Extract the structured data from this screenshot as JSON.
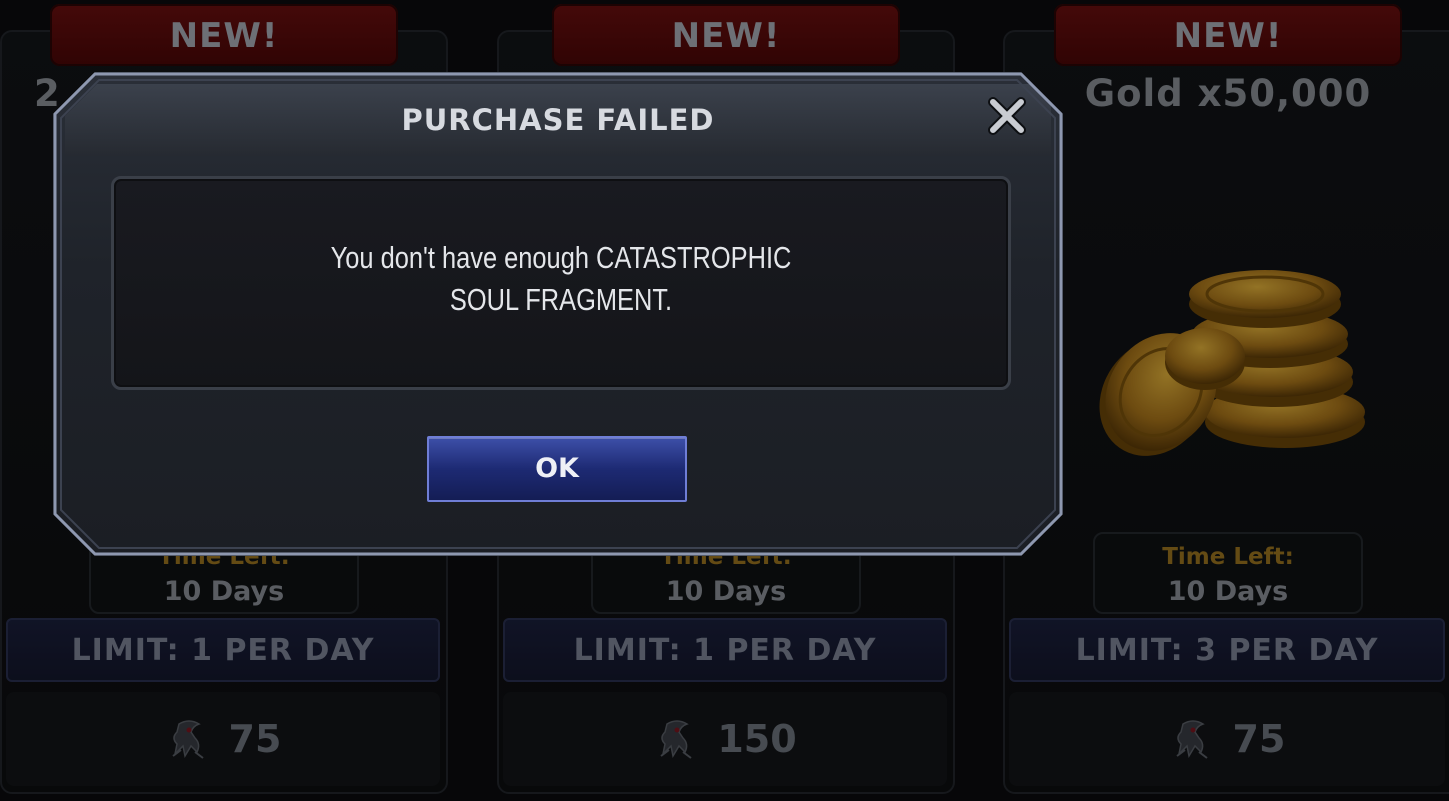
{
  "cards": [
    {
      "banner": "NEW!",
      "title": "2",
      "time_label": "Time Left:",
      "time_value": "10 Days",
      "limit": "LIMIT: 1 PER DAY",
      "price": "75",
      "currency_icon": "catastrophic-soul-fragment-icon"
    },
    {
      "banner": "NEW!",
      "title": "",
      "time_label": "Time Left:",
      "time_value": "10 Days",
      "limit": "LIMIT: 1 PER DAY",
      "price": "150",
      "currency_icon": "catastrophic-soul-fragment-icon"
    },
    {
      "banner": "NEW!",
      "title": "Gold x50,000",
      "time_label": "Time Left:",
      "time_value": "10 Days",
      "limit": "LIMIT: 3 PER DAY",
      "price": "75",
      "currency_icon": "catastrophic-soul-fragment-icon",
      "image": "gold-coins-image"
    }
  ],
  "dialog": {
    "title": "PURCHASE FAILED",
    "message_line1": "You don't have enough CATASTROPHIC",
    "message_line2": "SOUL FRAGMENT.",
    "ok_label": "OK",
    "close_icon": "close-icon"
  },
  "colors": {
    "banner_red": "#5a0b0b",
    "ok_blue": "#1d2a73",
    "time_label_gold": "#9a7420"
  }
}
